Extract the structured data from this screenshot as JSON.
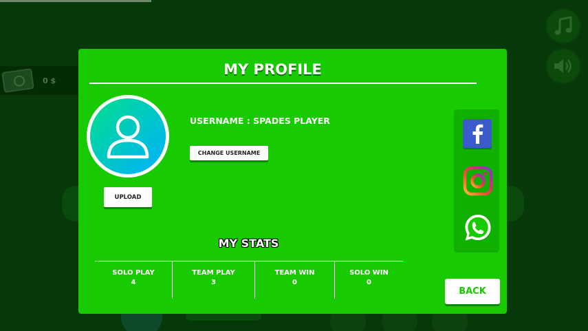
{
  "background": {
    "money": "0 $",
    "music_icon": "music-note-icon",
    "sound_icon": "speaker-icon"
  },
  "modal": {
    "title": "MY PROFILE",
    "username_text": "USERNAME : SPADES PLAYER",
    "change_username_label": "CHANGE USERNAME",
    "upload_label": "UPLOAD",
    "stats_title": "MY STATS",
    "stats": [
      {
        "label": "SOLO PLAY",
        "value": "4"
      },
      {
        "label": "TEAM PLAY",
        "value": "3"
      },
      {
        "label": "TEAM WIN",
        "value": "0"
      },
      {
        "label": "SOLO WIN",
        "value": "0"
      }
    ],
    "back_label": "BACK",
    "social": [
      "facebook-icon",
      "instagram-icon",
      "whatsapp-icon"
    ]
  },
  "colors": {
    "modal_green": "#17cb00",
    "panel_green": "#0fb000",
    "facebook_blue": "#3b5bcc",
    "avatar_gradient_start": "#00e08a",
    "avatar_gradient_end": "#00b0ff"
  }
}
